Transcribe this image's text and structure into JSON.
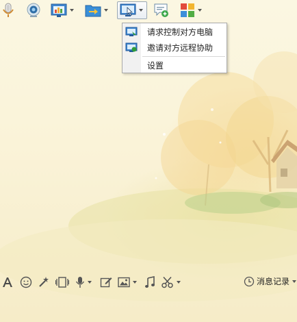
{
  "top_toolbar": {
    "items": [
      {
        "icon": "microphone-icon",
        "has_dropdown": false
      },
      {
        "icon": "webcam-icon",
        "has_dropdown": false
      },
      {
        "icon": "app-share-icon",
        "has_dropdown": true
      },
      {
        "icon": "file-transfer-icon",
        "has_dropdown": true
      },
      {
        "icon": "remote-desktop-icon",
        "has_dropdown": true,
        "pressed": true
      },
      {
        "icon": "add-chat-icon",
        "has_dropdown": false
      },
      {
        "icon": "apps-grid-icon",
        "has_dropdown": true
      }
    ]
  },
  "remote_menu": {
    "items": [
      {
        "label": "请求控制对方电脑",
        "icon": "request-control-icon"
      },
      {
        "label": "邀请对方远程协助",
        "icon": "invite-assist-icon"
      },
      {
        "label": "设置"
      }
    ]
  },
  "bottom_toolbar": {
    "items": [
      {
        "icon": "font-icon"
      },
      {
        "icon": "emoji-icon"
      },
      {
        "icon": "magic-wand-icon"
      },
      {
        "icon": "shake-window-icon"
      },
      {
        "icon": "voice-message-icon",
        "has_dropdown": true
      },
      {
        "icon": "edit-icon"
      },
      {
        "icon": "image-icon",
        "has_dropdown": true
      },
      {
        "icon": "music-icon"
      },
      {
        "icon": "screenshot-scissors-icon",
        "has_dropdown": true
      }
    ],
    "history_label": "消息记录"
  },
  "colors": {
    "accent_blue": "#2f7fc8",
    "menu_border": "#a9a9a9",
    "background": "#faf3d8"
  }
}
